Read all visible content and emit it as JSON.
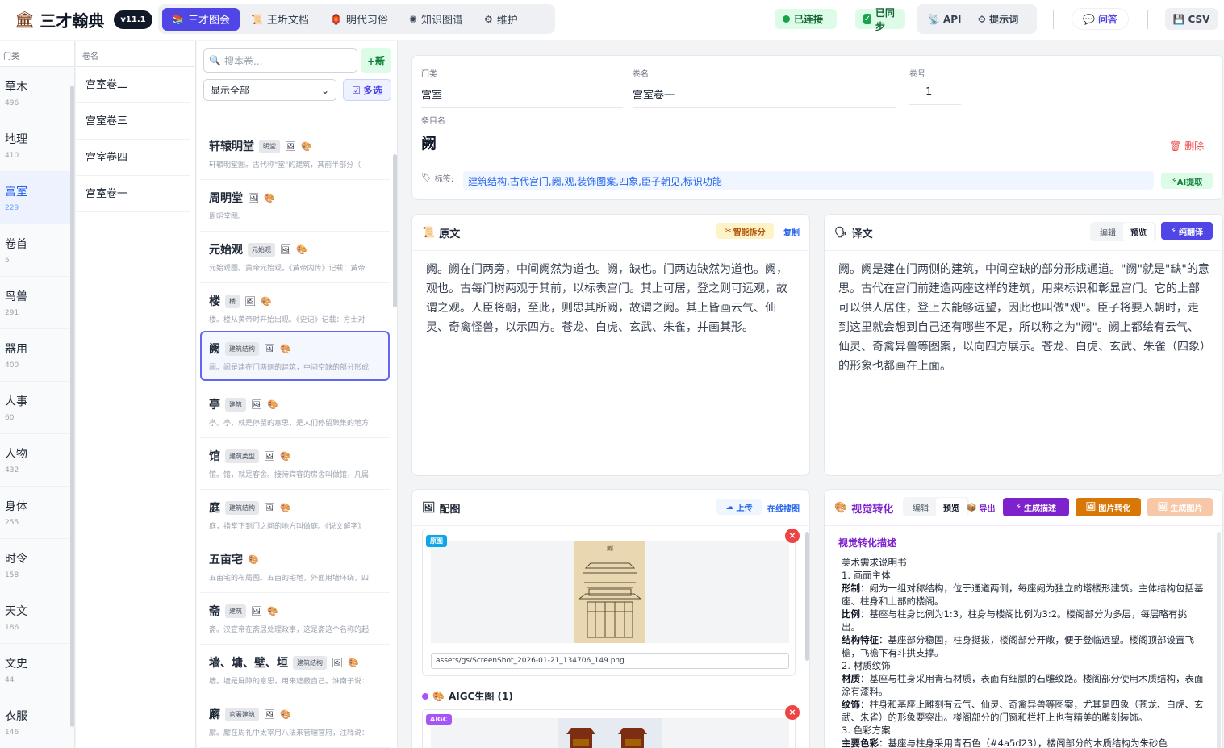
{
  "app": {
    "title": "三才翰典",
    "version": "v11.1"
  },
  "nav": [
    {
      "label": "三才图会",
      "icon": "books-icon"
    },
    {
      "label": "王圻文档",
      "icon": "scroll-icon"
    },
    {
      "label": "明代习俗",
      "icon": "lantern-icon"
    },
    {
      "label": "知识图谱",
      "icon": "graph-icon"
    },
    {
      "label": "维护",
      "icon": "gear-icon"
    }
  ],
  "status": {
    "connected": "已连接",
    "synced": "已同步"
  },
  "tools": {
    "api": "API",
    "prompt": "提示词",
    "ask": "问答",
    "csv": "CSV"
  },
  "categories": {
    "header": "门类",
    "items": [
      {
        "name": "草木",
        "count": "496"
      },
      {
        "name": "地理",
        "count": "410"
      },
      {
        "name": "宫室",
        "count": "229"
      },
      {
        "name": "卷首",
        "count": "5"
      },
      {
        "name": "鸟兽",
        "count": "291"
      },
      {
        "name": "器用",
        "count": "400"
      },
      {
        "name": "人事",
        "count": "60"
      },
      {
        "name": "人物",
        "count": "432"
      },
      {
        "name": "身体",
        "count": "255"
      },
      {
        "name": "时令",
        "count": "158"
      },
      {
        "name": "天文",
        "count": "186"
      },
      {
        "name": "文史",
        "count": "44"
      },
      {
        "name": "衣服",
        "count": "146"
      }
    ]
  },
  "volumes": {
    "header": "卷名",
    "items": [
      "宫室卷二",
      "宫室卷三",
      "宫室卷四",
      "宫室卷一"
    ]
  },
  "entrylist": {
    "search_placeholder": "搜本卷...",
    "new_label": "+新",
    "filter_value": "显示全部",
    "multi_label": "多选",
    "items": [
      {
        "name": "轩辕明堂",
        "tag": "明堂",
        "desc": "轩辕明堂图。古代称\"堂\"的建筑，其前半部分（"
      },
      {
        "name": "周明堂",
        "tag": "",
        "desc": "周明堂图。"
      },
      {
        "name": "元始观",
        "tag": "元始观",
        "desc": "元始观图。黄帝元始观，《黄帝内传》记载：黄帝"
      },
      {
        "name": "楼",
        "tag": "楼",
        "desc": "楼。楼从黄帝时开始出现。《史记》记载：方士对"
      },
      {
        "name": "阙",
        "tag": "建筑结构",
        "desc": "阙。阙是建在门两侧的建筑，中间空缺的部分形成"
      },
      {
        "name": "亭",
        "tag": "建筑",
        "desc": "亭。亭，就是停留的意思，是人们停留聚集的地方"
      },
      {
        "name": "馆",
        "tag": "建筑类型",
        "desc": "馆。馆，就是客舍。接待宾客的房舍叫做馆，凡属"
      },
      {
        "name": "庭",
        "tag": "建筑结构",
        "desc": "庭，指堂下到门之间的地方叫做庭。《说文解字》"
      },
      {
        "name": "五亩宅",
        "tag": "",
        "desc": "五亩宅的布局图。五亩的宅地，外面用墙环绕，四"
      },
      {
        "name": "斋",
        "tag": "建筑",
        "desc": "斋。汉宣帝在斋居处理政事，这是斋这个名称的起"
      },
      {
        "name": "墙、墉、壁、垣",
        "tag": "建筑结构",
        "desc": "墙。墙是屏障的意思，用来遮蔽自己。淮南子说："
      },
      {
        "name": "廨",
        "tag": "官署建筑",
        "desc": "廨。廨在周礼中太宰用八法来管理官府，注释说："
      }
    ]
  },
  "detail": {
    "category_label": "门类",
    "category": "宫室",
    "volume_label": "卷名",
    "volume": "宫室卷一",
    "volno_label": "卷号",
    "volno": "1",
    "entry_label": "条目名",
    "entry": "阙",
    "delete_label": "删除",
    "tags_label": "标签:",
    "tags": "建筑结构,古代宫门,阙,观,装饰图案,四象,臣子朝见,标识功能",
    "ai_label": "AI提取"
  },
  "original": {
    "title": "原文",
    "split_label": "智能拆分",
    "copy_label": "复制",
    "lines": [
      "阙。阙在门两旁，中间阙然为道也。阙，缺也。门两边缺然为道也。阙，",
      "观也。古每门树两观于其前，以标表宫门。其上可居，登之则可远观，故",
      "谓之观。人臣将朝，至此，则思其所阙，故谓之阙。其上皆画云气、仙",
      "灵、奇禽怪兽，以示四方。苍龙、白虎、玄武、朱雀，并画其形。"
    ]
  },
  "translation": {
    "title": "译文",
    "edit_label": "编辑",
    "preview_label": "预览",
    "translate_label": "纯翻译",
    "lines": [
      "阙。阙是建在门两侧的建筑，中间空缺的部分形成通道。\"阙\"就是\"缺\"的意",
      "思。古代在宫门前建造两座这样的建筑，用来标识和彰显宫门。它的上部",
      "可以供人居住，登上去能够远望，因此也叫做\"观\"。臣子将要入朝时，走",
      "到这里就会想到自己还有哪些不足，所以称之为\"阙\"。阙上都绘有云气、",
      "仙灵、奇禽异兽等图案，以向四方展示。苍龙、白虎、玄武、朱雀（四象）",
      "的形象也都画在上面。"
    ]
  },
  "images": {
    "title": "配图",
    "upload_label": "上传",
    "search_label": "在线搜图",
    "original_badge": "原图",
    "original_path": "assets/gs/ScreenShot_2026-01-21_134706_149.png",
    "aigc_title": "AIGC生图 (1)",
    "aigc_badge": "AIGC"
  },
  "visual": {
    "title": "视觉转化",
    "edit_label": "编辑",
    "preview_label": "预览",
    "export_label": "导出",
    "gen_desc_label": "生成描述",
    "img_convert_label": "图片转化",
    "gen_img_label": "生成图片",
    "heading": "视觉转化描述",
    "doc_title": "美术需求说明书",
    "s1": "1. 画面主体",
    "k1": "形制",
    "v1": "：阙为一组对称结构，位于通道两侧，每座阙为独立的塔楼形建筑。主体结构包括基座、柱身和上部的楼阁。",
    "k2": "比例",
    "v2": "：基座与柱身比例为1:3，柱身与楼阁比例为3:2。楼阁部分为多层，每层略有挑出。",
    "k3": "结构特征",
    "v3": "：基座部分稳固，柱身挺拔，楼阁部分开敞，便于登临远望。楼阁顶部设置飞檐，飞檐下有斗拱支撑。",
    "s2": "2. 材质纹饰",
    "k4": "材质",
    "v4": "：基座与柱身采用青石材质，表面有细腻的石雕纹路。楼阁部分使用木质结构，表面涂有漆料。",
    "k5": "纹饰",
    "v5": "：柱身和基座上雕刻有云气、仙灵、奇禽异兽等图案，尤其是四象（苍龙、白虎、玄武、朱雀）的形象要突出。楼阁部分的门窗和栏杆上也有精美的雕刻装饰。",
    "s3": "3. 色彩方案",
    "k6": "主要色彩",
    "v6": "：基座与柱身采用青石色（#4a5d23），楼阁部分的木质结构为朱砂色"
  }
}
